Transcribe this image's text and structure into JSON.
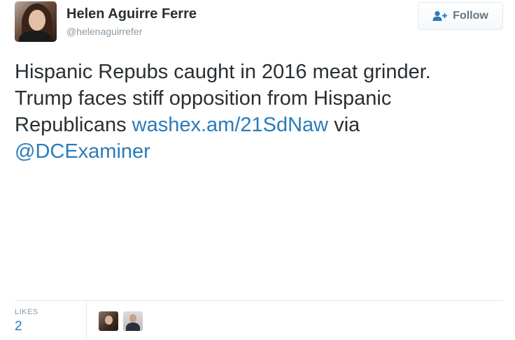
{
  "author": {
    "name": "Helen Aguirre Ferre",
    "handle": "@helenaguirrefer",
    "avatar_icon": "profile-photo"
  },
  "follow_button": {
    "label": "Follow",
    "icon": "add-user-icon"
  },
  "tweet": {
    "text_line1": "Hispanic Repubs caught in 2016 meat grinder.",
    "text_line2": "Trump faces stiff opposition from Hispanic",
    "text_line3_prefix": "Republicans ",
    "link": "washex.am/21SdNaw",
    "via": " via",
    "mention": "@DCExaminer"
  },
  "stats": {
    "likes_label": "LIKES",
    "likes_count": "2",
    "likers": [
      "liker-avatar-1",
      "liker-avatar-2"
    ]
  },
  "colors": {
    "link": "#2b7bb9",
    "text": "#292f33",
    "muted": "#8899a6",
    "border": "#e1e8ed"
  }
}
